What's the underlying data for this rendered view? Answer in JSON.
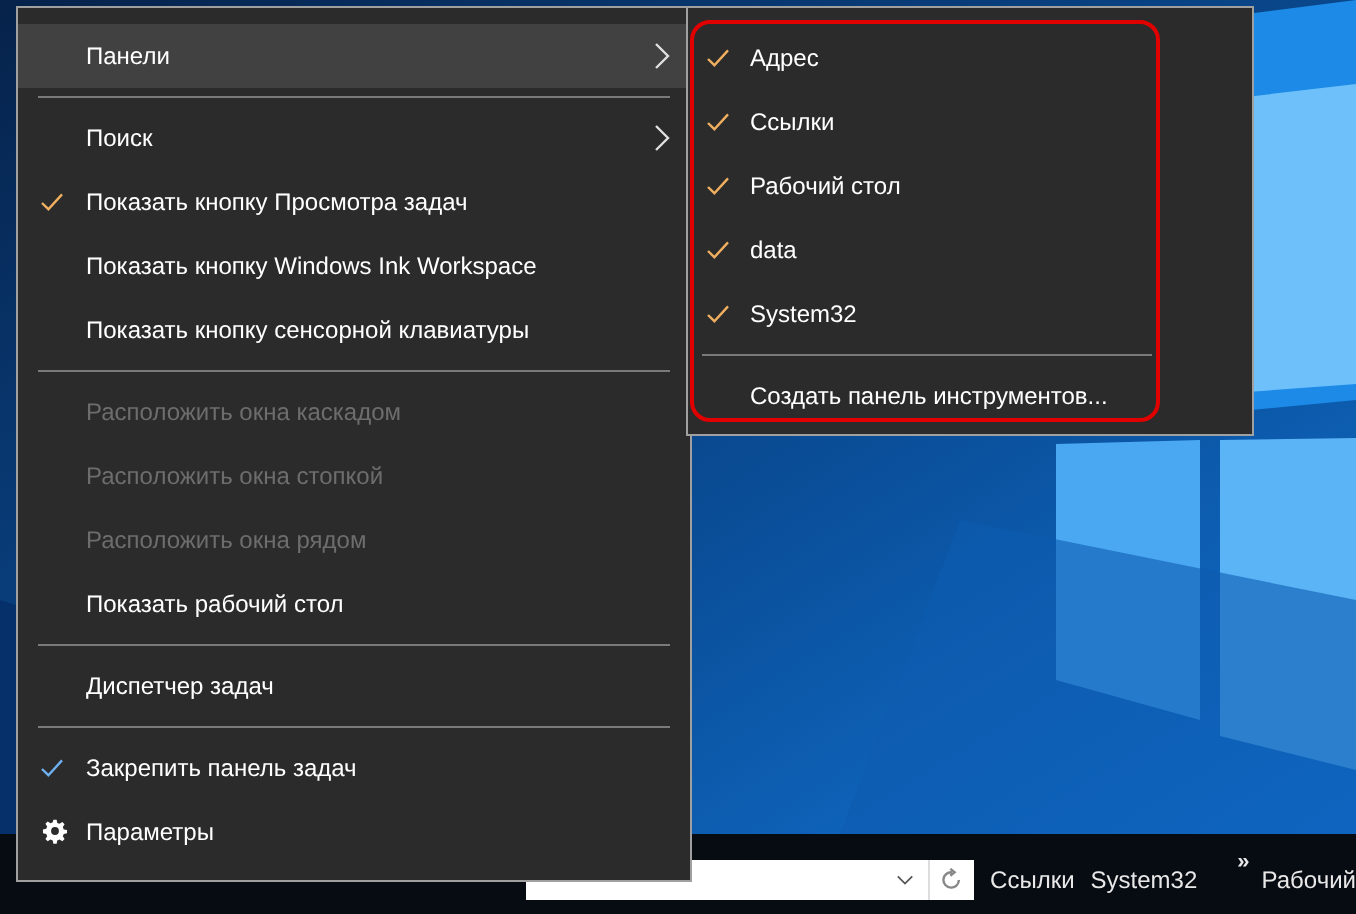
{
  "context_menu": {
    "groups": [
      [
        {
          "label": "Панели",
          "kind": "submenu",
          "selected": true,
          "checked": false,
          "disabled": false
        }
      ],
      [
        {
          "label": "Поиск",
          "kind": "submenu",
          "selected": false,
          "checked": false,
          "disabled": false
        },
        {
          "label": "Показать кнопку Просмотра задач",
          "kind": "command",
          "selected": false,
          "checked": true,
          "disabled": false,
          "color": "#f0b060"
        },
        {
          "label": "Показать кнопку Windows Ink Workspace",
          "kind": "command",
          "selected": false,
          "checked": false,
          "disabled": false
        },
        {
          "label": "Показать кнопку сенсорной клавиатуры",
          "kind": "command",
          "selected": false,
          "checked": false,
          "disabled": false
        }
      ],
      [
        {
          "label": "Расположить окна каскадом",
          "kind": "command",
          "selected": false,
          "checked": false,
          "disabled": true
        },
        {
          "label": "Расположить окна стопкой",
          "kind": "command",
          "selected": false,
          "checked": false,
          "disabled": true
        },
        {
          "label": "Расположить окна рядом",
          "kind": "command",
          "selected": false,
          "checked": false,
          "disabled": true
        },
        {
          "label": "Показать рабочий стол",
          "kind": "command",
          "selected": false,
          "checked": false,
          "disabled": false
        }
      ],
      [
        {
          "label": "Диспетчер задач",
          "kind": "command",
          "selected": false,
          "checked": false,
          "disabled": false
        }
      ],
      [
        {
          "label": "Закрепить панель задач",
          "kind": "command",
          "selected": false,
          "checked": true,
          "disabled": false,
          "color": "#6fb0f0"
        },
        {
          "label": "Параметры",
          "kind": "settings",
          "selected": false,
          "checked": false,
          "disabled": false
        }
      ]
    ]
  },
  "submenu": {
    "outlined": true,
    "groups": [
      [
        {
          "label": "Адрес",
          "checked": true,
          "color": "#f0b060"
        },
        {
          "label": "Ссылки",
          "checked": true,
          "color": "#f0b060"
        },
        {
          "label": "Рабочий стол",
          "checked": true,
          "color": "#f0b060"
        },
        {
          "label": "data",
          "checked": true,
          "color": "#f0b060"
        },
        {
          "label": "System32",
          "checked": true,
          "color": "#f0b060"
        }
      ],
      [
        {
          "label": "Создать панель инструментов...",
          "checked": false
        }
      ]
    ]
  },
  "taskbar": {
    "toolbars": [
      {
        "label": "Ссылки"
      },
      {
        "label": "System32"
      }
    ],
    "chevron": "»",
    "cut_toolbar": "Рабочий"
  }
}
